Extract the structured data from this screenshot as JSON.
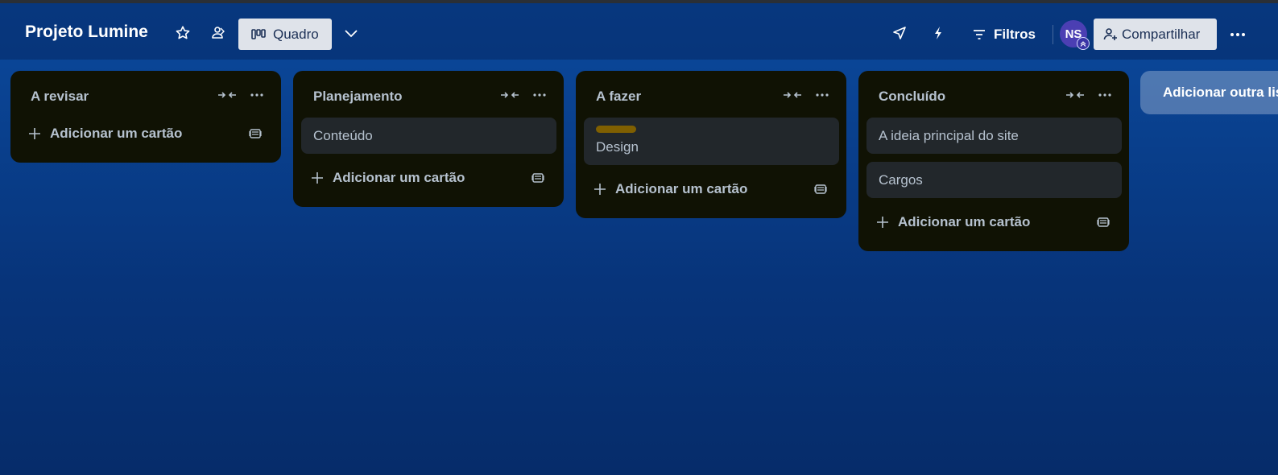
{
  "header": {
    "board_title": "Projeto Lumine",
    "view_label": "Quadro",
    "filters_label": "Filtros",
    "avatar_initials": "NS",
    "share_label": "Compartilhar"
  },
  "icons": {
    "star": "star-icon",
    "workspace": "workspace-visibility-icon",
    "view": "board-view-icon",
    "dropdown": "chevron-down-icon",
    "powerups": "rocket-icon",
    "automation": "lightning-icon",
    "filter": "filter-icon",
    "share": "add-member-icon",
    "more": "more-icon"
  },
  "lists": [
    {
      "title": "A revisar",
      "cards": [],
      "add_label": "Adicionar um cartão"
    },
    {
      "title": "Planejamento",
      "cards": [
        {
          "text": "Conteúdo"
        }
      ],
      "add_label": "Adicionar um cartão"
    },
    {
      "title": "A fazer",
      "cards": [
        {
          "text": "Design",
          "label_color": "#7f5f01"
        }
      ],
      "add_label": "Adicionar um cartão"
    },
    {
      "title": "Concluído",
      "cards": [
        {
          "text": "A ideia principal do site"
        },
        {
          "text": "Cargos"
        }
      ],
      "add_label": "Adicionar um cartão"
    }
  ],
  "add_list_label": "Adicionar outra lista",
  "colors": {
    "background": "#0b4a9e",
    "list_bg": "#101204",
    "card_bg": "#22272b",
    "text": "#b6c2cf",
    "button_bg": "#dfe3ea",
    "avatar": "#4b3fb3"
  }
}
